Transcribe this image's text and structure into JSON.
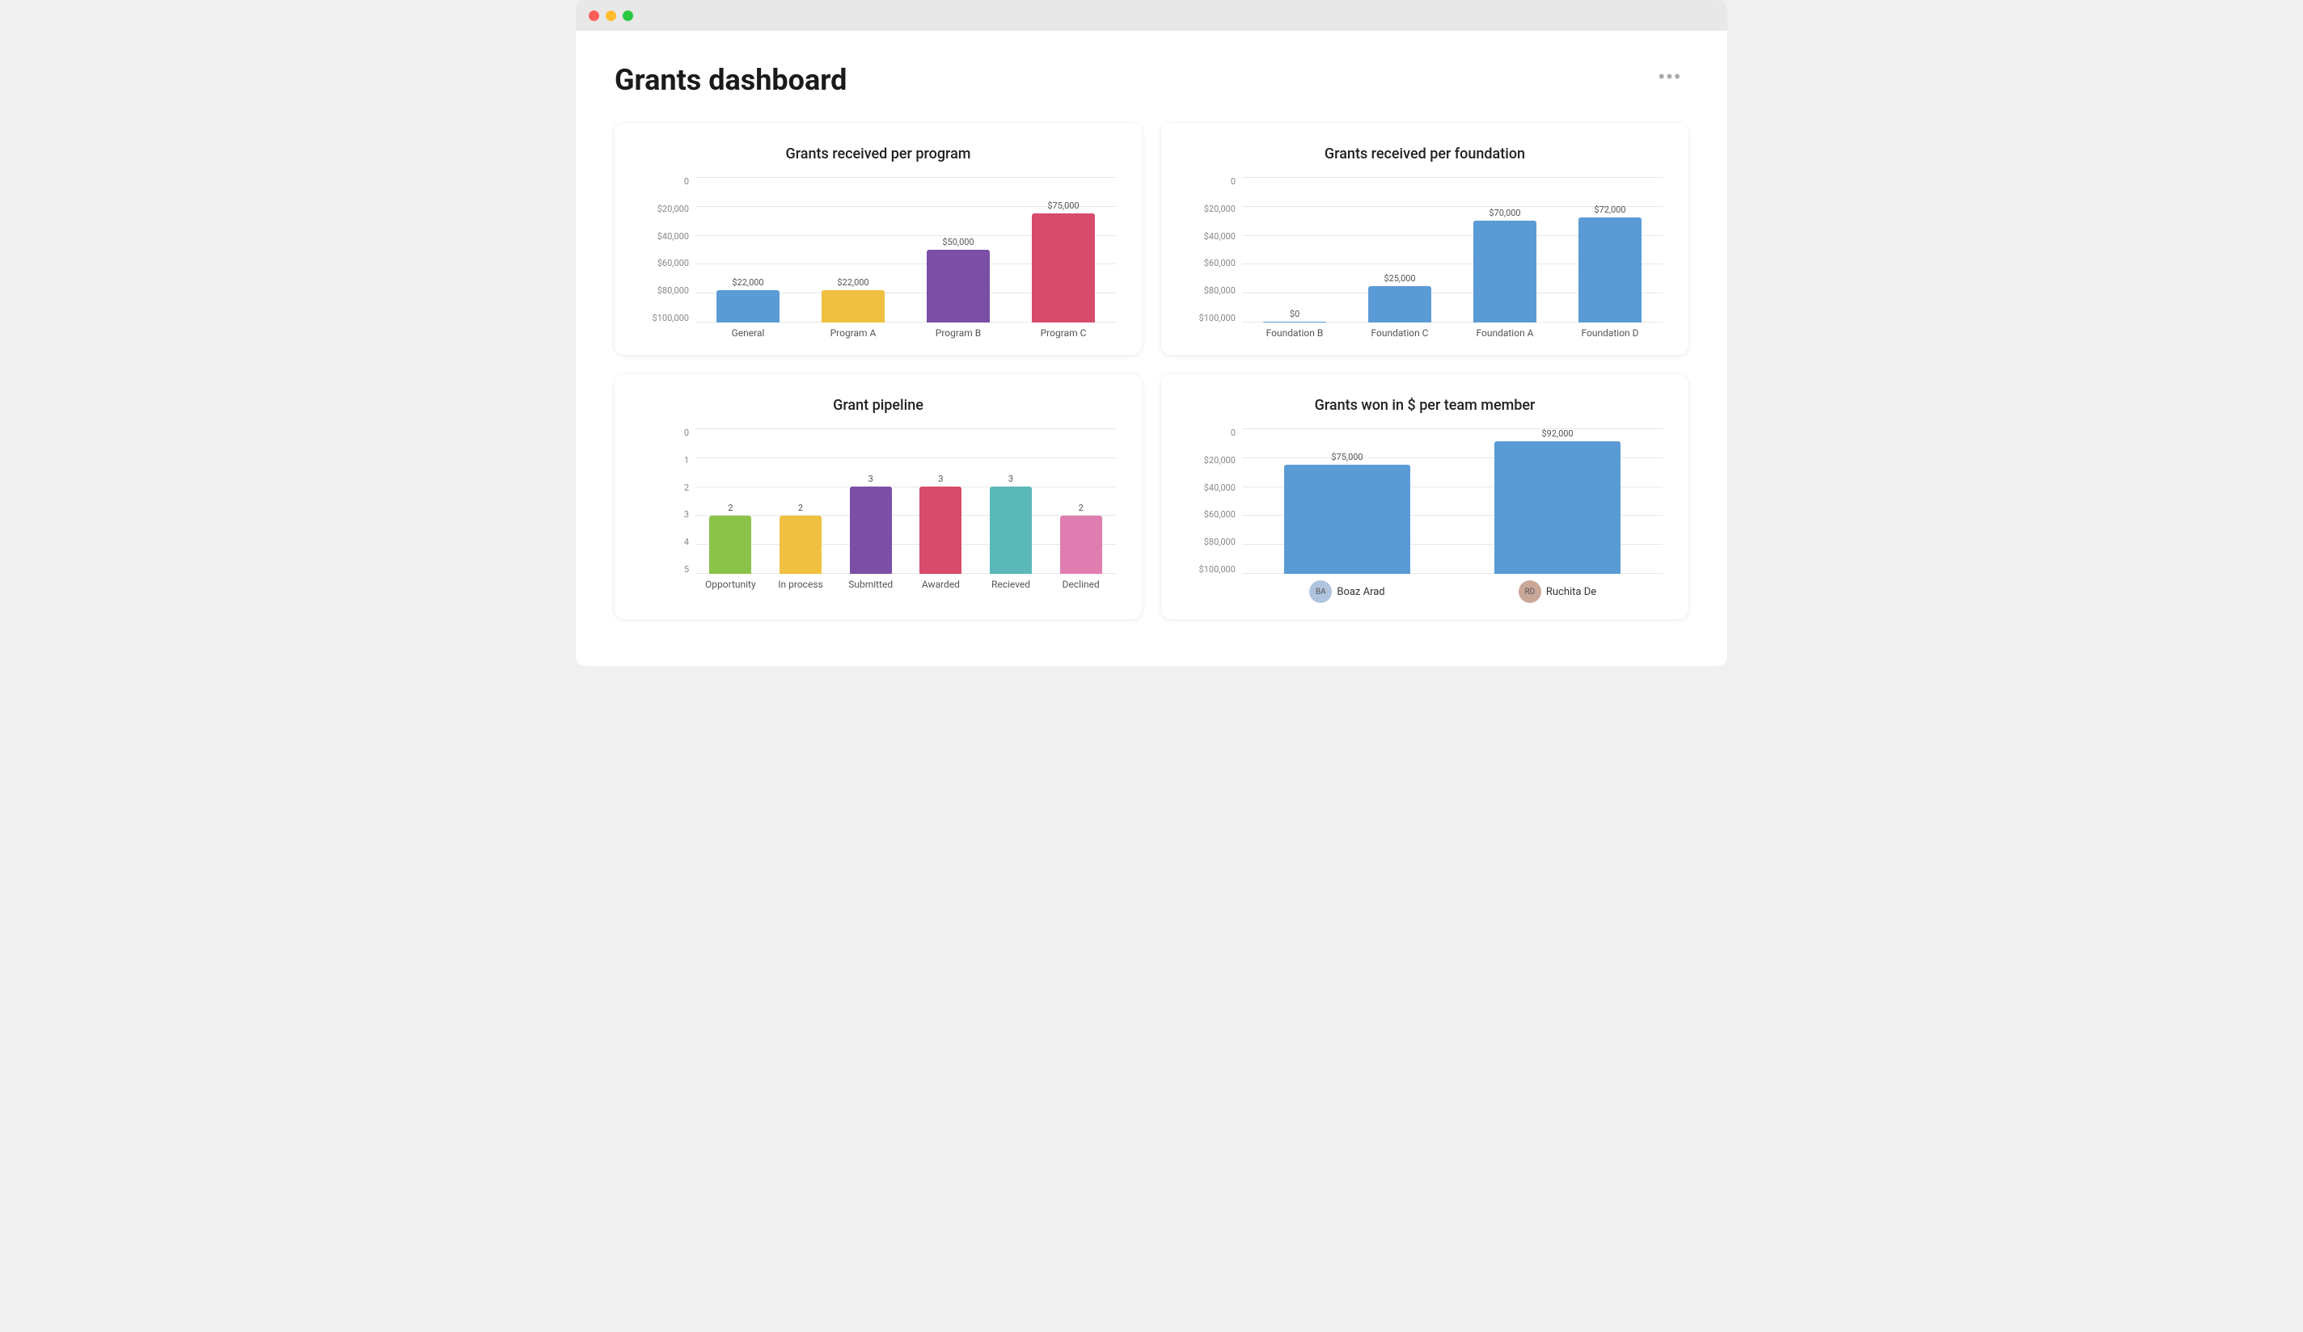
{
  "window": {
    "title": "Grants dashboard"
  },
  "header": {
    "title": "Grants dashboard",
    "more_icon": "•••"
  },
  "charts": {
    "grants_per_program": {
      "title": "Grants received per program",
      "y_labels": [
        "$100,000",
        "$80,000",
        "$60,000",
        "$40,000",
        "$20,000",
        "0"
      ],
      "max": 100000,
      "bars": [
        {
          "label": "General",
          "value": 22000,
          "display": "$22,000",
          "color": "#5b9bd5",
          "height_pct": 22
        },
        {
          "label": "Program A",
          "value": 22000,
          "display": "$22,000",
          "color": "#f0c040",
          "height_pct": 22
        },
        {
          "label": "Program B",
          "value": 50000,
          "display": "$50,000",
          "color": "#7b4fa6",
          "height_pct": 50
        },
        {
          "label": "Program C",
          "value": 75000,
          "display": "$75,000",
          "color": "#d84b6b",
          "height_pct": 75
        }
      ]
    },
    "grants_per_foundation": {
      "title": "Grants received per foundation",
      "y_labels": [
        "$100,000",
        "$80,000",
        "$60,000",
        "$40,000",
        "$20,000",
        "0"
      ],
      "max": 100000,
      "bars": [
        {
          "label": "Foundation B",
          "value": 0,
          "display": "$0",
          "color": "#5b9bd5",
          "height_pct": 0.5
        },
        {
          "label": "Foundation C",
          "value": 25000,
          "display": "$25,000",
          "color": "#5b9bd5",
          "height_pct": 25
        },
        {
          "label": "Foundation A",
          "value": 70000,
          "display": "$70,000",
          "color": "#5b9bd5",
          "height_pct": 70
        },
        {
          "label": "Foundation D",
          "value": 72000,
          "display": "$72,000",
          "color": "#5b9bd5",
          "height_pct": 72
        }
      ]
    },
    "grant_pipeline": {
      "title": "Grant pipeline",
      "y_labels": [
        "5",
        "4",
        "3",
        "2",
        "1",
        "0"
      ],
      "max": 5,
      "bars": [
        {
          "label": "Opportunity",
          "value": 2,
          "display": "2",
          "color": "#8bc34a",
          "height_pct": 40
        },
        {
          "label": "In process",
          "value": 2,
          "display": "2",
          "color": "#f0c040",
          "height_pct": 40
        },
        {
          "label": "Submitted",
          "value": 3,
          "display": "3",
          "color": "#7b4fa6",
          "height_pct": 60
        },
        {
          "label": "Awarded",
          "value": 3,
          "display": "3",
          "color": "#d84b6b",
          "height_pct": 60
        },
        {
          "label": "Recieved",
          "value": 3,
          "display": "3",
          "color": "#5bb8b8",
          "height_pct": 60
        },
        {
          "label": "Declined",
          "value": 2,
          "display": "2",
          "color": "#e07db0",
          "height_pct": 40
        }
      ]
    },
    "grants_per_member": {
      "title": "Grants won in $ per team member",
      "y_labels": [
        "$100,000",
        "$80,000",
        "$60,000",
        "$40,000",
        "$20,000",
        "0"
      ],
      "max": 100000,
      "bars": [
        {
          "label": "Boaz Arad",
          "value": 75000,
          "display": "$75,000",
          "color": "#5b9bd5",
          "height_pct": 75,
          "avatar": "BA"
        },
        {
          "label": "Ruchita De",
          "value": 92000,
          "display": "$92,000",
          "color": "#5b9bd5",
          "height_pct": 92,
          "avatar": "RD"
        }
      ]
    }
  }
}
